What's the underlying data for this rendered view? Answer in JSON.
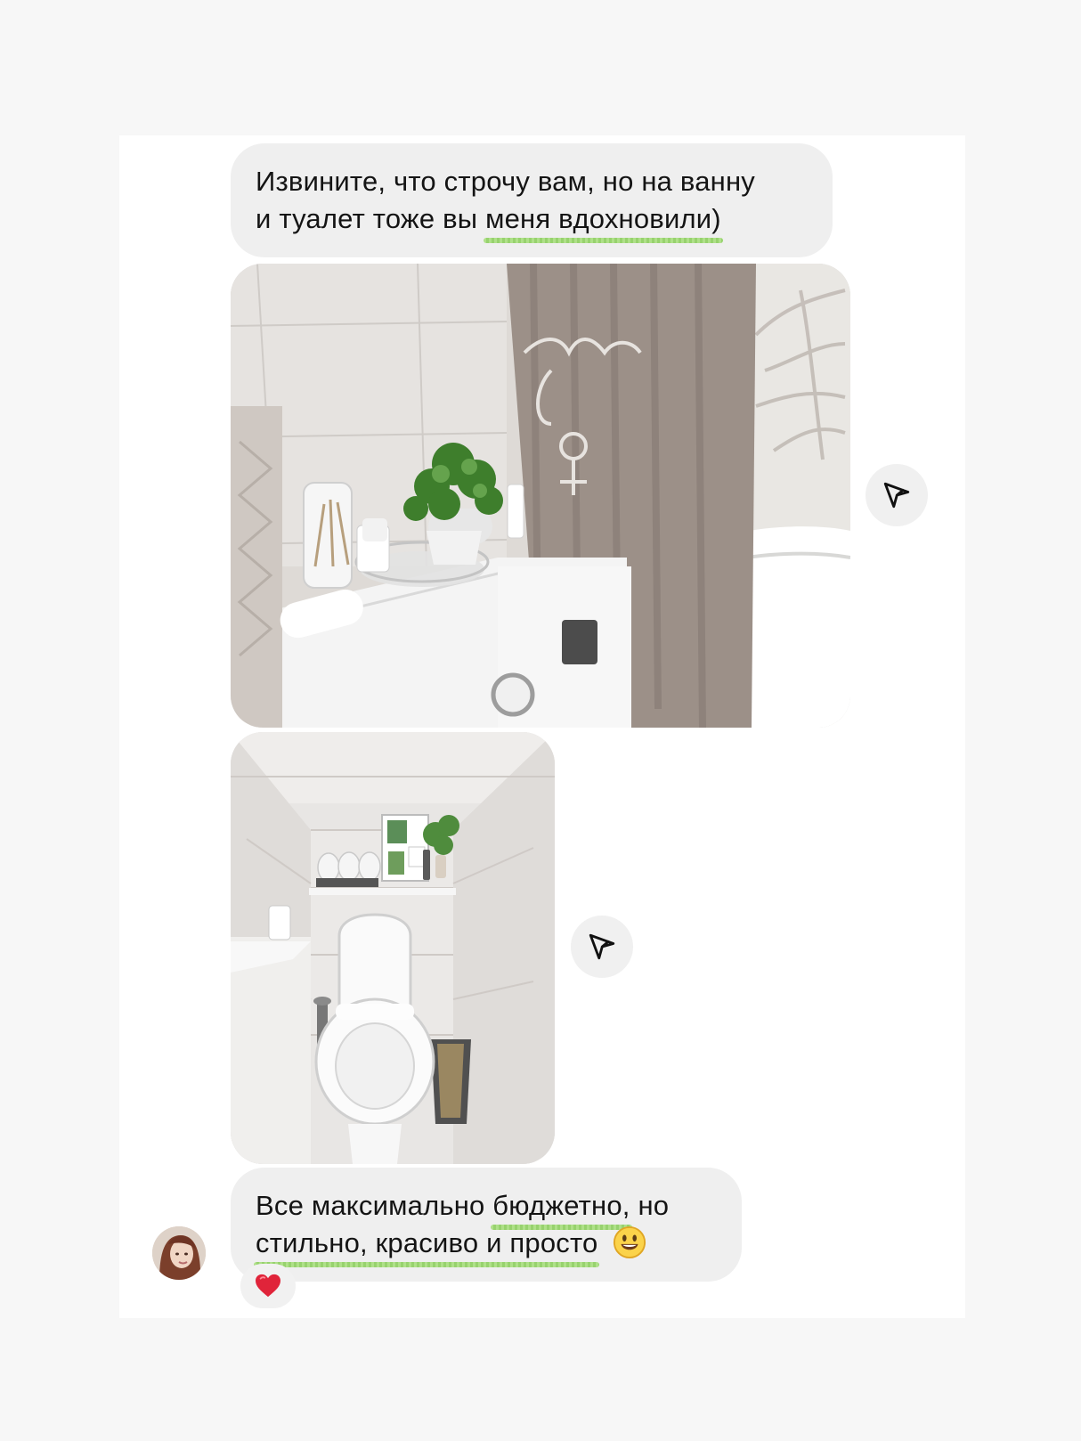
{
  "messages": {
    "first": {
      "line1": "Извините, что строчу вам, но на ванну",
      "line2_start": "и туалет тоже вы ",
      "line2_highlight": "меня вдохновили)"
    },
    "last": {
      "line1_start": "Все максимально ",
      "line1_highlight": "бюджетно,",
      "line1_end": " но",
      "line2_highlight": "стильно, красиво и просто"
    }
  },
  "icons": {
    "share": "send-icon",
    "reaction": "heart-icon",
    "smile": "smiley-icon"
  },
  "colors": {
    "bubble": "#efefef",
    "highlight": "#a8de7e",
    "heart": "#e0243a",
    "text": "#141414"
  }
}
